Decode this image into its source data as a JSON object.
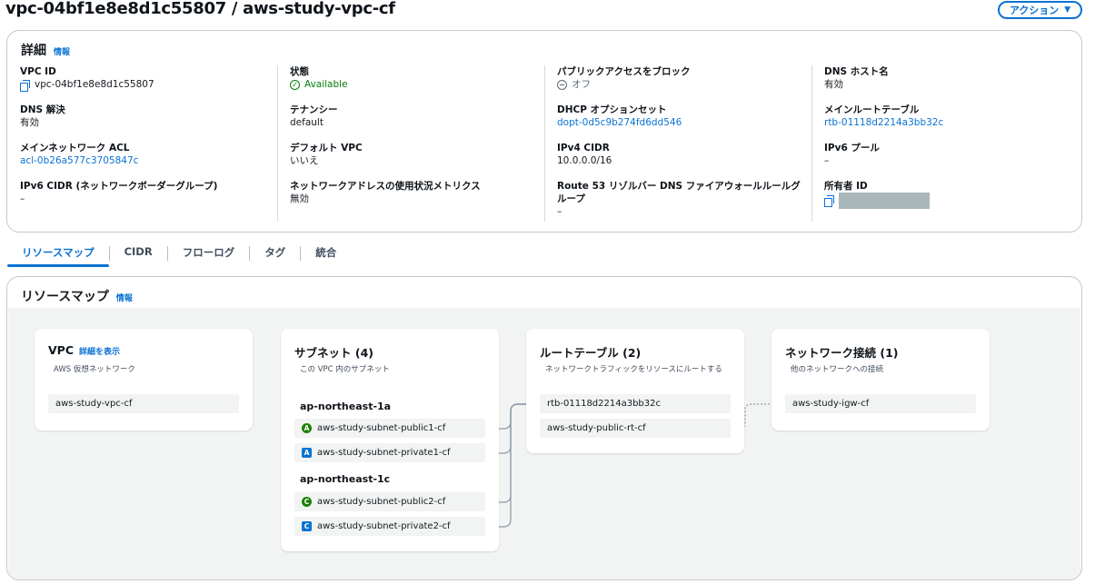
{
  "header": {
    "title": "vpc-04bf1e8e8d1c55807 / aws-study-vpc-cf",
    "action_label": "アクション"
  },
  "details": {
    "heading": "詳細",
    "info": "情報",
    "col1": [
      {
        "label": "VPC ID",
        "value": "vpc-04bf1e8e8d1c55807"
      },
      {
        "label": "DNS 解決",
        "value": "有効"
      },
      {
        "label": "メインネットワーク ACL",
        "value": "acl-0b26a577c3705847c"
      },
      {
        "label": "IPv6 CIDR (ネットワークボーダーグループ)",
        "value": "–"
      }
    ],
    "col2": [
      {
        "label": "状態",
        "value": "Available"
      },
      {
        "label": "テナンシー",
        "value": "default"
      },
      {
        "label": "デフォルト VPC",
        "value": "いいえ"
      },
      {
        "label": "ネットワークアドレスの使用状況メトリクス",
        "value": "無効"
      }
    ],
    "col3": [
      {
        "label": "パブリックアクセスをブロック",
        "value": "オフ"
      },
      {
        "label": "DHCP オプションセット",
        "value": "dopt-0d5c9b274fd6dd546"
      },
      {
        "label": "IPv4 CIDR",
        "value": "10.0.0.0/16"
      },
      {
        "label": "Route 53 リゾルバー DNS ファイアウォールルールグループ",
        "value": "–"
      }
    ],
    "col4": [
      {
        "label": "DNS ホスト名",
        "value": "有効"
      },
      {
        "label": "メインルートテーブル",
        "value": "rtb-01118d2214a3bb32c"
      },
      {
        "label": "IPv6 プール",
        "value": "–"
      },
      {
        "label": "所有者 ID",
        "value": ""
      }
    ]
  },
  "tabs": [
    "リソースマップ",
    "CIDR",
    "フローログ",
    "タグ",
    "統合"
  ],
  "resource_map": {
    "heading": "リソースマップ",
    "info": "情報",
    "vpc": {
      "title": "VPC",
      "link": "詳細を表示",
      "subtitle": "AWS 仮想ネットワーク",
      "name": "aws-study-vpc-cf"
    },
    "subnets": {
      "title": "サブネット (4)",
      "subtitle": "この VPC 内のサブネット",
      "zones": [
        {
          "name": "ap-northeast-1a",
          "items": [
            {
              "badge": "A",
              "kind": "public",
              "name": "aws-study-subnet-public1-cf"
            },
            {
              "badge": "A",
              "kind": "private",
              "name": "aws-study-subnet-private1-cf"
            }
          ]
        },
        {
          "name": "ap-northeast-1c",
          "items": [
            {
              "badge": "C",
              "kind": "public",
              "name": "aws-study-subnet-public2-cf"
            },
            {
              "badge": "C",
              "kind": "private",
              "name": "aws-study-subnet-private2-cf"
            }
          ]
        }
      ]
    },
    "route_tables": {
      "title": "ルートテーブル (2)",
      "subtitle": "ネットワークトラフィックをリソースにルートする",
      "items": [
        "rtb-01118d2214a3bb32c",
        "aws-study-public-rt-cf"
      ]
    },
    "connections": {
      "title": "ネットワーク接続 (1)",
      "subtitle": "他のネットワークへの接続",
      "items": [
        "aws-study-igw-cf"
      ]
    }
  },
  "colors": {
    "link": "#0972d3",
    "available": "#037f0c",
    "public_badge": "#1d8102",
    "private_badge": "#0972d3"
  }
}
